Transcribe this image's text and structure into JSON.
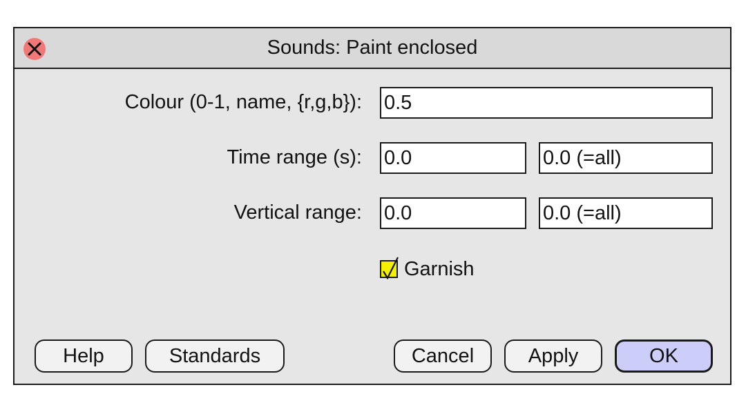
{
  "window": {
    "title": "Sounds: Paint enclosed"
  },
  "form": {
    "colour_label": "Colour (0-1, name, {r,g,b}):",
    "colour_value": "0.5",
    "time_range_label": "Time range (s):",
    "time_range_from": "0.0",
    "time_range_to": "0.0 (=all)",
    "vertical_range_label": "Vertical range:",
    "vertical_range_from": "0.0",
    "vertical_range_to": "0.0 (=all)",
    "garnish_label": "Garnish",
    "garnish_checked": true
  },
  "buttons": {
    "help": "Help",
    "standards": "Standards",
    "cancel": "Cancel",
    "apply": "Apply",
    "ok": "OK"
  },
  "colors": {
    "window_bg": "#e6e6e6",
    "titlebar_bg": "#d9d9d9",
    "close_button": "#f27878",
    "checkbox_checked": "#f5ef00",
    "default_button": "#cccdf9"
  },
  "icons": {
    "close": "close-x-icon",
    "check": "checkmark-icon"
  }
}
